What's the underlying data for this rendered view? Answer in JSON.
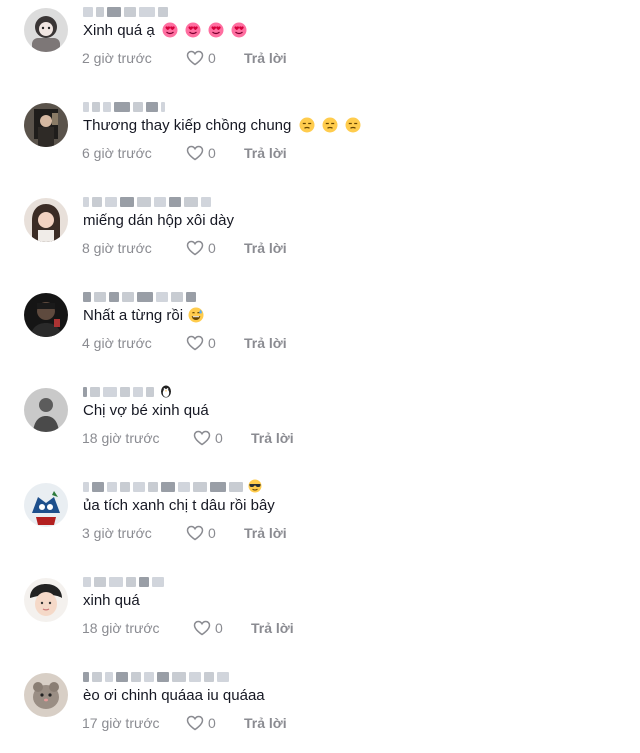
{
  "comments": [
    {
      "text": "Xinh quá ạ",
      "emojis": [
        "heart-eyes",
        "heart-eyes",
        "heart-eyes",
        "heart-eyes"
      ],
      "time": "2 giờ trước",
      "likes": "0",
      "reply_label": "Trả lời"
    },
    {
      "text": "Thương thay kiếp chồng chung",
      "emojis": [
        "pensive",
        "pensive",
        "pensive"
      ],
      "time": "6 giờ trước",
      "likes": "0",
      "reply_label": "Trả lời"
    },
    {
      "text": "miếng dán hộp xôi dày",
      "emojis": [],
      "time": "8 giờ trước",
      "likes": "0",
      "reply_label": "Trả lời"
    },
    {
      "text": "Nhất a từng rồi",
      "emojis": [
        "grin-sweat"
      ],
      "time": "4 giờ trước",
      "likes": "0",
      "reply_label": "Trả lời"
    },
    {
      "text": "Chị vợ bé xinh quá",
      "emojis": [],
      "time": "18 giờ trước",
      "likes": "0",
      "reply_label": "Trả lời"
    },
    {
      "text": "ủa tích xanh chị t dâu rồi bây",
      "emojis": [],
      "time": "3 giờ trước",
      "likes": "0",
      "reply_label": "Trả lời"
    },
    {
      "text": "xinh quá",
      "emojis": [],
      "time": "18 giờ trước",
      "likes": "0",
      "reply_label": "Trả lời"
    },
    {
      "text": "èo ơi chinh quáaa iu quáaa",
      "emojis": [],
      "time": "17 giờ trước",
      "likes": "0",
      "reply_label": "Trả lời"
    }
  ],
  "icons": {
    "like": "heart-outline-icon",
    "username": "blurred-username"
  },
  "colors": {
    "text": "#161823",
    "meta": "#8a8b91",
    "background": "#ffffff"
  }
}
